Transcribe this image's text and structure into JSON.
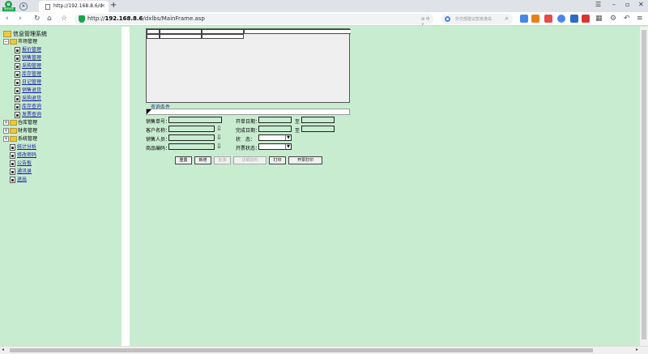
{
  "browser": {
    "logo_text": "e",
    "logo_label": "瑞雪浏览",
    "tab_title": "http://192.168.8.6/dxlbs/Mai",
    "address_host": "192.168.8.6",
    "address_prefix": "http://",
    "address_path": "/dxlbs/MainFrame.asp",
    "search_placeholder": "外交部建议暂离港岛",
    "addr_hint": "⊞ 中 ∨"
  },
  "sidebar": {
    "root": "信息管理系统",
    "groups": [
      {
        "label": "市场管理",
        "expanded": true,
        "items": [
          "报价管理",
          "销售管理",
          "采购管理",
          "库存管理",
          "日记管理",
          "销售退货",
          "采购退货",
          "库存查询",
          "发票查询"
        ]
      },
      {
        "label": "仓库管理",
        "expanded": false,
        "items": []
      },
      {
        "label": "财务管理",
        "expanded": false,
        "items": []
      },
      {
        "label": "系统管理",
        "expanded": false,
        "items": []
      }
    ],
    "tail": [
      "统计分析",
      "修改密码",
      "公告板",
      "通讯录",
      "退出"
    ]
  },
  "query": {
    "title": "查询条件",
    "sales_no_label": "销售单号：",
    "open_date_label": "开单日期：",
    "to_label": "至",
    "customer_label": "客户名称：",
    "finish_date_label": "完成日期：",
    "to_label2": "至",
    "salesman_label": "销售人员：",
    "status_label": "状　态：",
    "product_label": "商品编码：",
    "invoice_status_label": "开票状态："
  },
  "buttons": {
    "reset": "重置",
    "new": "新增",
    "approve": "批准",
    "detail": "详细资料",
    "print": "打印",
    "invoice_print": "开票打印"
  },
  "colors": {
    "page_bg": "#c8ecd0",
    "link": "#1a1aa0"
  }
}
